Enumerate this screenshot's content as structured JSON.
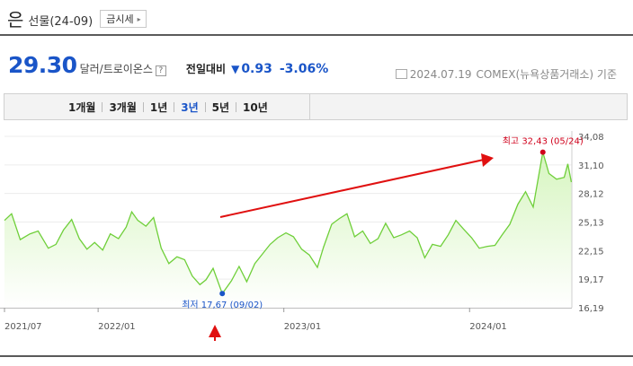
{
  "header": {
    "title": "은",
    "subtitle": "선물(24-09)",
    "price_button": "금시세"
  },
  "quote": {
    "price": "29.30",
    "unit": "달러/트로이온스",
    "help": "?",
    "change_label": "전일대비",
    "change_symbol": "▼",
    "change_value": "0.93",
    "change_percent": "-3.06%",
    "date": "2024.07.19",
    "source": "COMEX(뉴욕상품거래소) 기준"
  },
  "tabs": [
    "1개월",
    "3개월",
    "1년",
    "3년",
    "5년",
    "10년"
  ],
  "active_tab": "3년",
  "colors": {
    "line": "#6fcf3a",
    "area_top": "#d6f5bf",
    "price_blue": "#1a55c8",
    "high_red": "#d0001b",
    "low_blue": "#1a55c8"
  },
  "chart_data": {
    "type": "area",
    "y_ticks": [
      "34,08",
      "31,10",
      "28,12",
      "25,13",
      "22,15",
      "19,17",
      "16,19"
    ],
    "y_range": [
      16.19,
      34.08
    ],
    "x_range": [
      "2021-07",
      "2024-07"
    ],
    "x_ticks": [
      {
        "label": "2021/07",
        "date": "2021-07"
      },
      {
        "label": "2022/01",
        "date": "2022-01"
      },
      {
        "label": "2023/01",
        "date": "2023-01"
      },
      {
        "label": "2024/01",
        "date": "2024-01"
      }
    ],
    "high_label": "최고 32,43 (05/24)",
    "low_label": "최저 17,67 (09/02)",
    "high": {
      "date": "2024-05-24",
      "value": 32.43
    },
    "low": {
      "date": "2022-09-02",
      "value": 17.67
    },
    "series": [
      {
        "values": [
          [
            "2021-07-01",
            25.3
          ],
          [
            "2021-07-15",
            26.0
          ],
          [
            "2021-08-01",
            23.3
          ],
          [
            "2021-08-20",
            23.9
          ],
          [
            "2021-09-05",
            24.2
          ],
          [
            "2021-09-25",
            22.4
          ],
          [
            "2021-10-10",
            22.8
          ],
          [
            "2021-10-25",
            24.3
          ],
          [
            "2021-11-10",
            25.4
          ],
          [
            "2021-11-25",
            23.4
          ],
          [
            "2021-12-10",
            22.3
          ],
          [
            "2021-12-25",
            23.0
          ],
          [
            "2022-01-10",
            22.2
          ],
          [
            "2022-01-25",
            23.9
          ],
          [
            "2022-02-10",
            23.4
          ],
          [
            "2022-02-25",
            24.6
          ],
          [
            "2022-03-08",
            26.2
          ],
          [
            "2022-03-20",
            25.3
          ],
          [
            "2022-04-05",
            24.7
          ],
          [
            "2022-04-20",
            25.6
          ],
          [
            "2022-05-05",
            22.4
          ],
          [
            "2022-05-20",
            20.8
          ],
          [
            "2022-06-05",
            21.5
          ],
          [
            "2022-06-20",
            21.2
          ],
          [
            "2022-07-05",
            19.5
          ],
          [
            "2022-07-20",
            18.6
          ],
          [
            "2022-08-01",
            19.1
          ],
          [
            "2022-08-15",
            20.3
          ],
          [
            "2022-09-02",
            17.67
          ],
          [
            "2022-09-20",
            19.0
          ],
          [
            "2022-10-05",
            20.5
          ],
          [
            "2022-10-20",
            18.9
          ],
          [
            "2022-11-05",
            20.8
          ],
          [
            "2022-11-20",
            21.8
          ],
          [
            "2022-12-05",
            22.8
          ],
          [
            "2022-12-20",
            23.5
          ],
          [
            "2023-01-05",
            24.0
          ],
          [
            "2023-01-20",
            23.6
          ],
          [
            "2023-02-05",
            22.3
          ],
          [
            "2023-02-20",
            21.7
          ],
          [
            "2023-03-08",
            20.4
          ],
          [
            "2023-03-20",
            22.5
          ],
          [
            "2023-04-05",
            24.9
          ],
          [
            "2023-04-20",
            25.5
          ],
          [
            "2023-05-05",
            26.0
          ],
          [
            "2023-05-20",
            23.6
          ],
          [
            "2023-06-05",
            24.2
          ],
          [
            "2023-06-20",
            22.9
          ],
          [
            "2023-07-05",
            23.4
          ],
          [
            "2023-07-20",
            25.0
          ],
          [
            "2023-08-05",
            23.5
          ],
          [
            "2023-08-20",
            23.8
          ],
          [
            "2023-09-05",
            24.2
          ],
          [
            "2023-09-20",
            23.5
          ],
          [
            "2023-10-05",
            21.4
          ],
          [
            "2023-10-20",
            22.8
          ],
          [
            "2023-11-05",
            22.6
          ],
          [
            "2023-11-20",
            23.8
          ],
          [
            "2023-12-05",
            25.3
          ],
          [
            "2023-12-20",
            24.4
          ],
          [
            "2024-01-05",
            23.5
          ],
          [
            "2024-01-20",
            22.4
          ],
          [
            "2024-02-05",
            22.6
          ],
          [
            "2024-02-20",
            22.7
          ],
          [
            "2024-03-05",
            23.8
          ],
          [
            "2024-03-20",
            24.9
          ],
          [
            "2024-04-05",
            27.0
          ],
          [
            "2024-04-20",
            28.3
          ],
          [
            "2024-05-05",
            26.7
          ],
          [
            "2024-05-24",
            32.43
          ],
          [
            "2024-06-05",
            30.2
          ],
          [
            "2024-06-20",
            29.6
          ],
          [
            "2024-07-05",
            29.8
          ],
          [
            "2024-07-12",
            31.2
          ],
          [
            "2024-07-19",
            29.3
          ]
        ]
      }
    ]
  }
}
